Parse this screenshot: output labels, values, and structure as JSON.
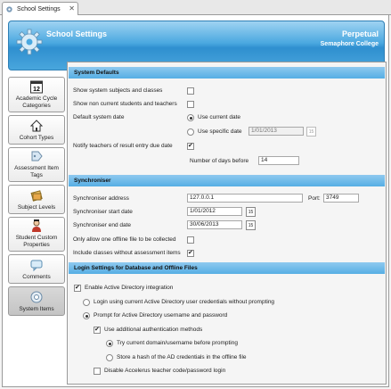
{
  "tab": {
    "title": "School Settings",
    "close": "✕"
  },
  "header": {
    "title": "School Settings",
    "product": "Perpetual",
    "school": "Semaphore College"
  },
  "nav": {
    "items": [
      {
        "label": "Academic Cycle Categories",
        "icon": "calendar-12-icon"
      },
      {
        "label": "Cohort Types",
        "icon": "house-icon"
      },
      {
        "label": "Assessment Item Tags",
        "icon": "tag-icon"
      },
      {
        "label": "Subject Levels",
        "icon": "books-icon"
      },
      {
        "label": "Student Custom Properties",
        "icon": "student-icon"
      },
      {
        "label": "Comments",
        "icon": "comment-icon"
      },
      {
        "label": "System Items",
        "icon": "gear-icon",
        "active": true
      }
    ]
  },
  "system_defaults": {
    "heading": "System Defaults",
    "show_system_subjects": {
      "label": "Show system subjects and classes",
      "checked": false
    },
    "show_non_current": {
      "label": "Show non current students and teachers",
      "checked": false
    },
    "default_date_label": "Default system date",
    "use_current_date": {
      "label": "Use current date",
      "selected": true
    },
    "use_specific_date": {
      "label": "Use specific date",
      "selected": false,
      "value": "1/01/2013",
      "cal": "15"
    },
    "notify_teachers": {
      "label": "Notify teachers of result entry due date",
      "checked": true
    },
    "days_before": {
      "label": "Number of days before",
      "value": "14"
    }
  },
  "synchroniser": {
    "heading": "Synchroniser",
    "address": {
      "label": "Synchroniser address",
      "value": "127.0.0.1"
    },
    "port": {
      "label": "Port:",
      "value": "3749"
    },
    "start_date": {
      "label": "Synchroniser start date",
      "value": "1/01/2012",
      "cal": "15"
    },
    "end_date": {
      "label": "Synchroniser end date",
      "value": "30/06/2013",
      "cal": "15"
    },
    "one_offline": {
      "label": "Only allow one offline file to be collected",
      "checked": false
    },
    "include_classes": {
      "label": "Include classes without assessment items",
      "checked": true
    }
  },
  "login": {
    "heading": "Login Settings for Database and Offline Files",
    "enable_ad": {
      "label": "Enable Active Directory integration",
      "checked": true
    },
    "login_current": {
      "label": "Login using current Active Directory user credentials without prompting",
      "selected": false
    },
    "prompt_ad": {
      "label": "Prompt for Active Directory username and password",
      "selected": true
    },
    "use_additional": {
      "label": "Use additional authentication methods",
      "checked": true
    },
    "try_current": {
      "label": "Try current domain/username before prompting",
      "selected": true
    },
    "store_hash": {
      "label": "Store a hash of the AD credentials in the offline file",
      "selected": false
    },
    "disable_accelerus": {
      "label": "Disable Accelerus teacher code/password login",
      "checked": false
    }
  },
  "colors": {
    "banner": "#3a9bd8",
    "section": "#6cb8e8",
    "nav_active": "#c8c8c8"
  }
}
